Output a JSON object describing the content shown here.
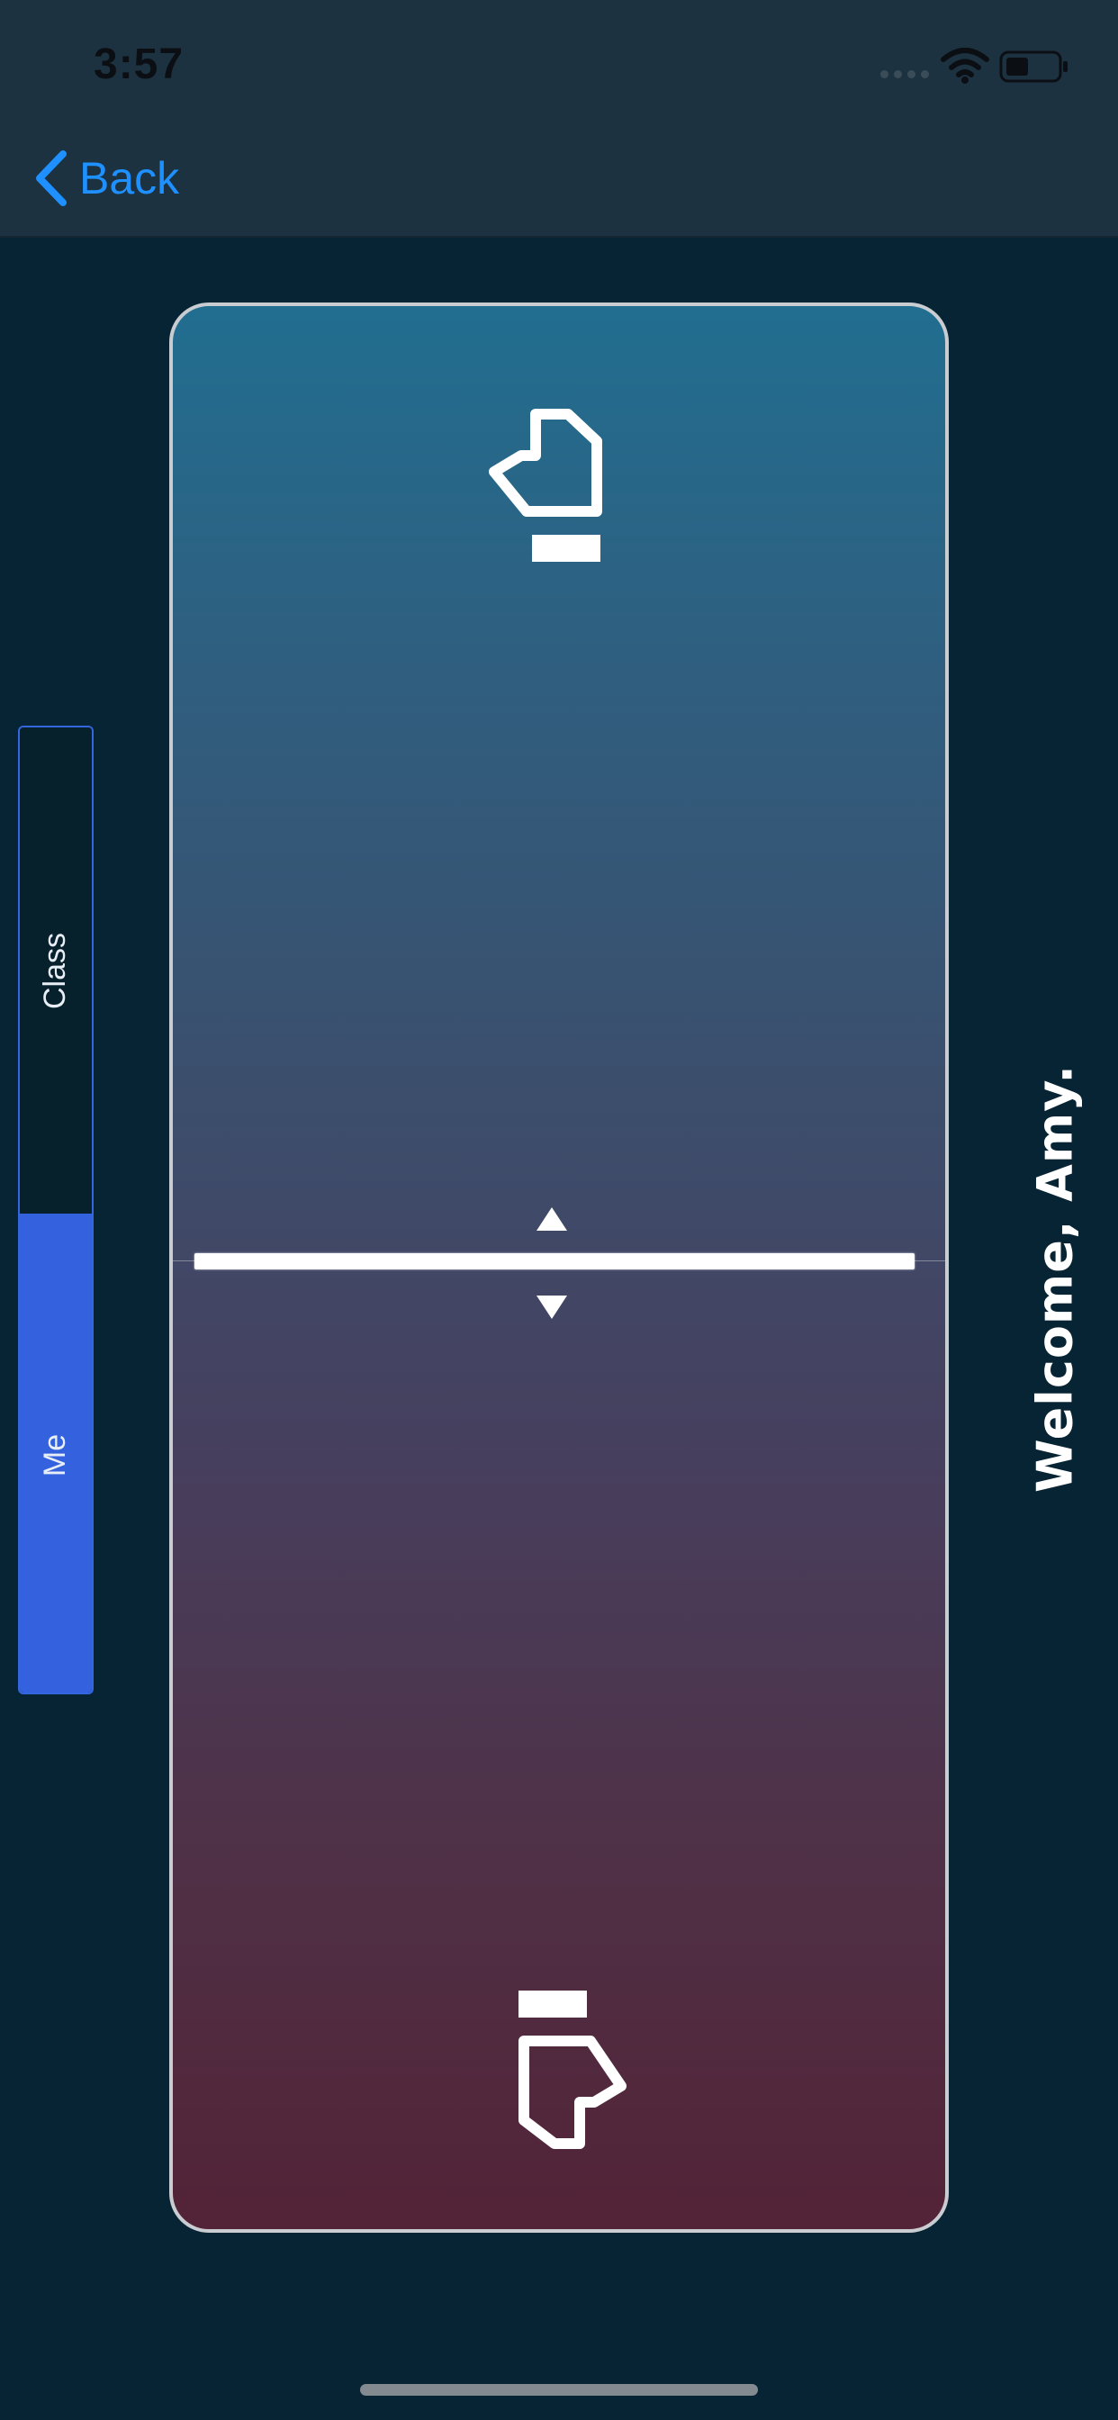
{
  "status_bar": {
    "time": "3:57",
    "icons": [
      "signal-dots-icon",
      "wifi-icon",
      "battery-icon"
    ]
  },
  "nav": {
    "back_label": "Back",
    "back_icon": "chevron-left-icon",
    "accent_color": "#1e90ff"
  },
  "toggle": {
    "options": [
      {
        "label": "Class",
        "selected": false
      },
      {
        "label": "Me",
        "selected": true
      }
    ],
    "selected_color": "#3462de"
  },
  "card": {
    "top_icon": "hand-raised-icon",
    "bottom_icon": "hand-lowered-icon",
    "handle_icons": [
      "arrow-up-icon",
      "arrow-down-icon"
    ],
    "gradient_top_color": "#216e90",
    "gradient_bottom_color": "#532337"
  },
  "welcome": {
    "text": "Welcome, Amy."
  }
}
